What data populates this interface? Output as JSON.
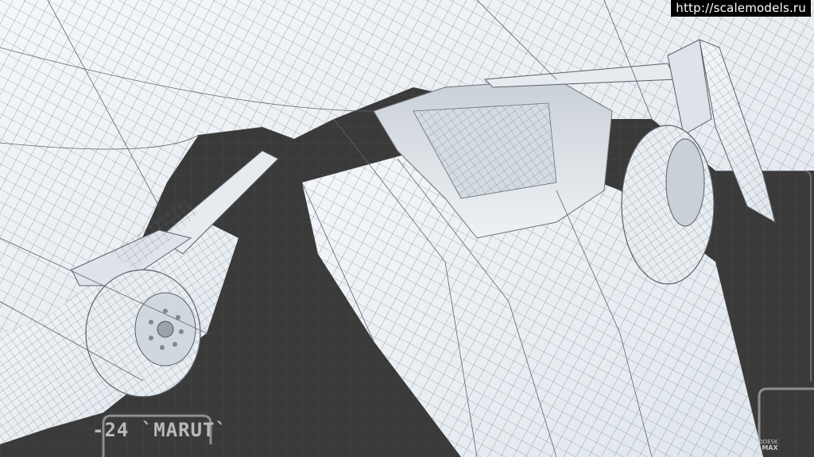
{
  "watermark": {
    "text": "http://scalemodels.ru"
  },
  "caption": {
    "text": "-24 `MARUT`"
  },
  "software_badge": {
    "line1": "TODESK",
    "line2": "MAX"
  },
  "colors": {
    "background_dark": "#3a3a3a",
    "grid_line": "#4c4c4c",
    "model_surface": "#e9eef2",
    "wireframe": "#5a6068",
    "hud_outline": "#9a9a9a"
  }
}
